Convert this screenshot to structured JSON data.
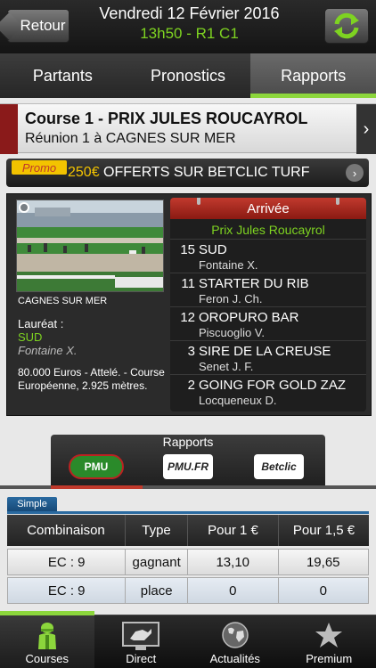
{
  "header": {
    "back_label": "Retour",
    "date": "Vendredi 12 Février 2016",
    "course_code": "13h50 - R1 C1"
  },
  "tabs": [
    {
      "label": "Partants",
      "active": false
    },
    {
      "label": "Pronostics",
      "active": false
    },
    {
      "label": "Rapports",
      "active": true
    }
  ],
  "course": {
    "title": "Course 1 - PRIX JULES ROUCAYROL",
    "subtitle": "Réunion 1 à CAGNES SUR MER"
  },
  "promo": {
    "tag": "Promo",
    "amount": "250€",
    "text": " OFFERTS SUR BETCLIC TURF"
  },
  "info": {
    "location": "CAGNES SUR MER",
    "laureat_label": "Lauréat :",
    "laureat_name": "SUD",
    "laureat_jockey": "Fontaine X.",
    "description": "80.000 Euros - Attelé. - Course Européenne, 2.925 mètres."
  },
  "arrivee": {
    "header": "Arrivée",
    "race_name": "Prix Jules Roucayrol",
    "runners": [
      {
        "num": "15",
        "horse": "SUD",
        "jockey": "Fontaine X."
      },
      {
        "num": "11",
        "horse": "STARTER DU RIB",
        "jockey": "Feron J. Ch."
      },
      {
        "num": "12",
        "horse": "OROPURO BAR",
        "jockey": "Piscuoglio V."
      },
      {
        "num": "3",
        "horse": "SIRE DE LA CREUSE",
        "jockey": "Senet J. F."
      },
      {
        "num": "2",
        "horse": "GOING FOR GOLD ZAZ",
        "jockey": "Locqueneux D."
      }
    ]
  },
  "rapports": {
    "title": "Rapports",
    "logos": [
      "PMU",
      "PMU.FR",
      "Betclic"
    ]
  },
  "simple": {
    "label": "Simple",
    "columns": [
      "Combinaison",
      "Type",
      "Pour 1 €",
      "Pour 1,5 €"
    ],
    "rows": [
      [
        "EC : 9",
        "gagnant",
        "13,10",
        "19,65"
      ],
      [
        "EC : 9",
        "place",
        "0",
        "0"
      ]
    ]
  },
  "bottom_nav": [
    {
      "label": "Courses",
      "icon": "jockey-icon",
      "active": true
    },
    {
      "label": "Direct",
      "icon": "tv-horse-icon",
      "active": false
    },
    {
      "label": "Actualités",
      "icon": "globe-icon",
      "active": false
    },
    {
      "label": "Premium",
      "icon": "star-icon",
      "active": false
    }
  ],
  "colors": {
    "accent_green": "#8cd63c",
    "header_red": "#c13a2e",
    "promo_yellow": "#f3c300"
  }
}
